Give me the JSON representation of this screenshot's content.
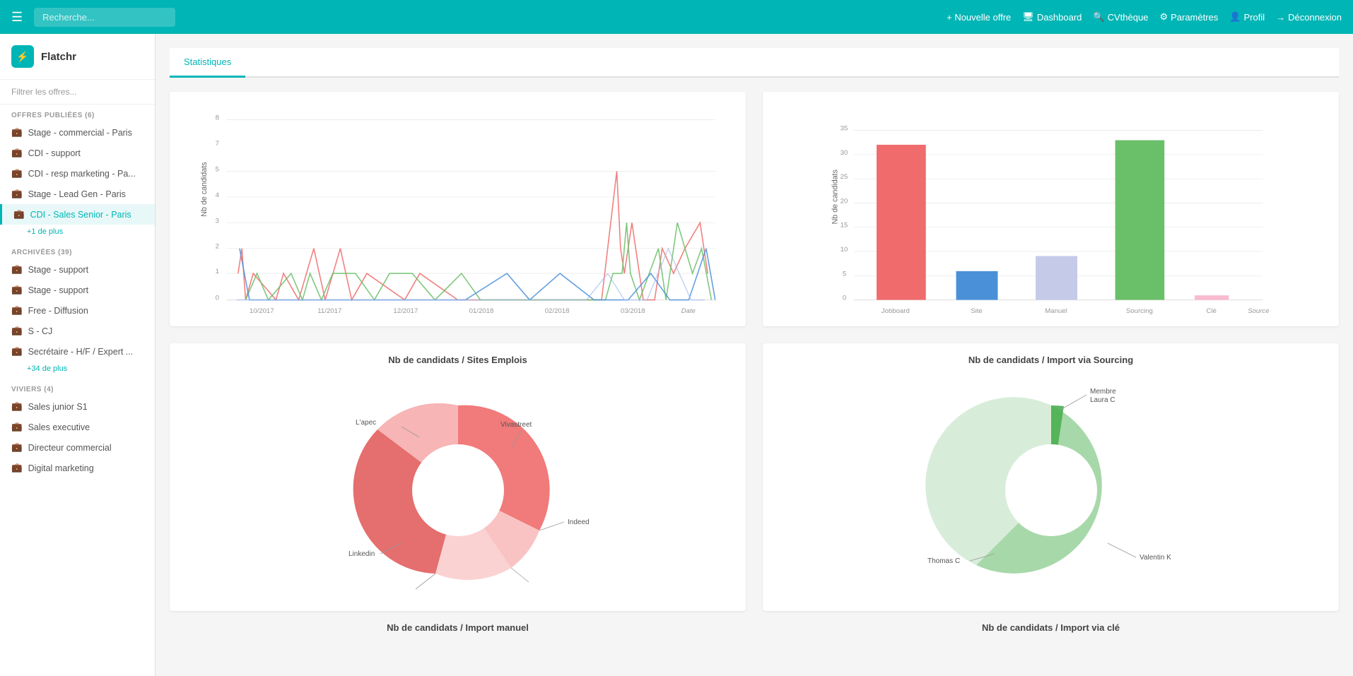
{
  "navbar": {
    "menu_icon": "☰",
    "search_placeholder": "Recherche...",
    "nouvelle_offre": "+ Nouvelle offre",
    "dashboard": "Dashboard",
    "cvtheque": "CVthèque",
    "parametres": "Paramètres",
    "profil": "Profil",
    "deconnexion": "Déconnexion"
  },
  "sidebar": {
    "brand_name": "Flatchr",
    "brand_icon": "⚡",
    "filter_placeholder": "Filtrer les offres...",
    "sections": [
      {
        "title": "OFFRES PUBLIÉES (6)",
        "items": [
          {
            "label": "Stage - commercial - Paris",
            "active": false
          },
          {
            "label": "CDI - support",
            "active": false
          },
          {
            "label": "CDI - resp marketing - Pa...",
            "active": false
          },
          {
            "label": "Stage - Lead Gen - Paris",
            "active": false
          },
          {
            "label": "CDI - Sales Senior - Paris",
            "active": true
          }
        ],
        "more": "+1 de plus"
      },
      {
        "title": "ARCHIVÉES (39)",
        "items": [
          {
            "label": "Stage - support",
            "active": false
          },
          {
            "label": "Stage - support",
            "active": false
          },
          {
            "label": "Free - Diffusion",
            "active": false
          },
          {
            "label": "S - CJ",
            "active": false
          },
          {
            "label": "Secrétaire - H/F / Expert ...",
            "active": false
          }
        ],
        "more": "+34 de plus"
      },
      {
        "title": "VIVIERS (4)",
        "items": [
          {
            "label": "Sales junior S1",
            "active": false
          },
          {
            "label": "Sales executive",
            "active": false
          },
          {
            "label": "Directeur commercial",
            "active": false
          },
          {
            "label": "Digital marketing",
            "active": false
          }
        ],
        "more": null
      }
    ]
  },
  "tabs": [
    {
      "label": "Statistiques",
      "active": true
    }
  ],
  "charts": {
    "line_chart": {
      "title": "",
      "y_label": "Nb de candidats",
      "x_label": "Date",
      "x_ticks": [
        "10/2017",
        "11/2017",
        "12/2017",
        "01/2018",
        "02/2018",
        "03/2018"
      ],
      "y_max": 8
    },
    "bar_chart": {
      "title": "",
      "y_label": "Nb de candidats",
      "x_label": "Source",
      "bars": [
        {
          "label": "Jobboard",
          "value": 32,
          "color": "#f06b6b"
        },
        {
          "label": "Site",
          "value": 6,
          "color": "#4a90d9"
        },
        {
          "label": "Manuel",
          "value": 9,
          "color": "#c5cae9"
        },
        {
          "label": "Sourcing",
          "value": 33,
          "color": "#6abf69"
        },
        {
          "label": "Clé",
          "value": 1,
          "color": "#f8bbd0"
        }
      ],
      "y_max": 35
    },
    "donut_sites": {
      "title": "Nb de candidats / Sites Emplois",
      "segments": [
        {
          "label": "Indeed",
          "value": 45,
          "color": "#f06b6b"
        },
        {
          "label": "Vivastreet",
          "value": 10,
          "color": "#f9b4b4"
        },
        {
          "label": "L'apec",
          "value": 12,
          "color": "#f9b4b4"
        },
        {
          "label": "Linkedin",
          "value": 28,
          "color": "#e05555"
        }
      ]
    },
    "donut_sourcing": {
      "title": "Nb de candidats / Import via Sourcing",
      "segments": [
        {
          "label": "Membre Laura C",
          "value": 5,
          "color": "#4caf50"
        },
        {
          "label": "Thomas C",
          "value": 55,
          "color": "#81c784"
        },
        {
          "label": "Valentin K",
          "value": 38,
          "color": "#c8e6c9"
        }
      ]
    },
    "donut_manuel": {
      "title": "Nb de candidats / Import manuel"
    },
    "donut_cle": {
      "title": "Nb de candidats / Import via clé"
    }
  }
}
